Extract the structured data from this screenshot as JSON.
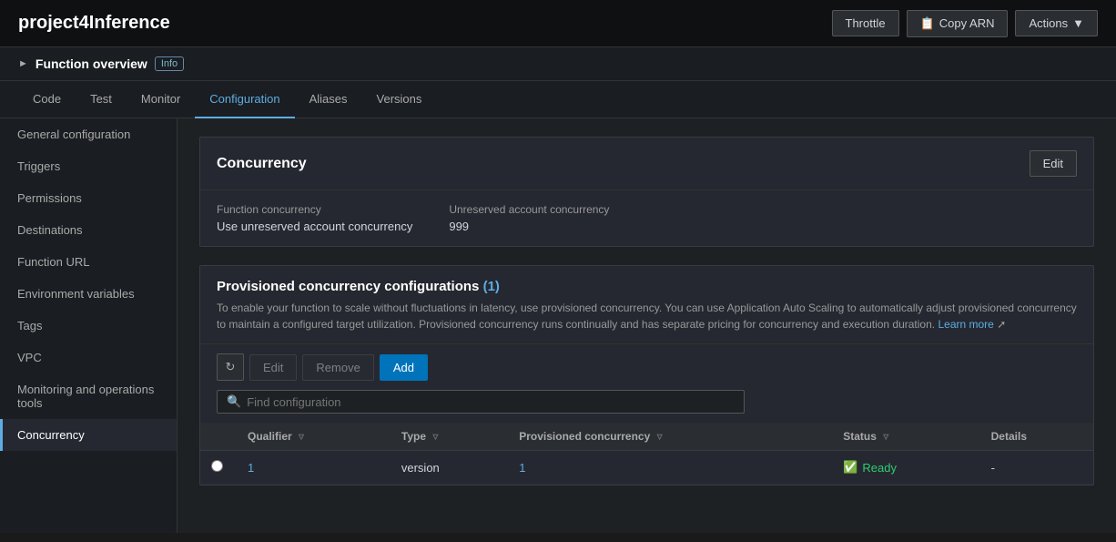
{
  "header": {
    "title": "project4Inference",
    "throttle_label": "Throttle",
    "copy_arn_label": "Copy ARN",
    "actions_label": "Actions"
  },
  "overview": {
    "title": "Function overview",
    "info_label": "Info"
  },
  "tabs": [
    {
      "id": "code",
      "label": "Code"
    },
    {
      "id": "test",
      "label": "Test"
    },
    {
      "id": "monitor",
      "label": "Monitor"
    },
    {
      "id": "configuration",
      "label": "Configuration",
      "active": true
    },
    {
      "id": "aliases",
      "label": "Aliases"
    },
    {
      "id": "versions",
      "label": "Versions"
    }
  ],
  "sidebar": {
    "items": [
      {
        "id": "general",
        "label": "General configuration"
      },
      {
        "id": "triggers",
        "label": "Triggers"
      },
      {
        "id": "permissions",
        "label": "Permissions"
      },
      {
        "id": "destinations",
        "label": "Destinations"
      },
      {
        "id": "function-url",
        "label": "Function URL"
      },
      {
        "id": "env-vars",
        "label": "Environment variables"
      },
      {
        "id": "tags",
        "label": "Tags"
      },
      {
        "id": "vpc",
        "label": "VPC"
      },
      {
        "id": "monitoring",
        "label": "Monitoring and operations tools"
      },
      {
        "id": "concurrency",
        "label": "Concurrency",
        "active": true
      }
    ]
  },
  "concurrency": {
    "title": "Concurrency",
    "edit_label": "Edit",
    "function_concurrency_label": "Function concurrency",
    "function_concurrency_value": "Use unreserved account concurrency",
    "unreserved_label": "Unreserved account concurrency",
    "unreserved_value": "999"
  },
  "provisioned": {
    "title": "Provisioned concurrency configurations",
    "count": "(1)",
    "description": "To enable your function to scale without fluctuations in latency, use provisioned concurrency. You can use Application Auto Scaling to automatically adjust provisioned concurrency to maintain a configured target utilization. Provisioned concurrency runs continually and has separate pricing for concurrency and execution duration.",
    "learn_more": "Learn more",
    "refresh_title": "Refresh",
    "edit_label": "Edit",
    "remove_label": "Remove",
    "add_label": "Add",
    "search_placeholder": "Find configuration",
    "table": {
      "columns": [
        {
          "id": "qualifier",
          "label": "Qualifier"
        },
        {
          "id": "type",
          "label": "Type"
        },
        {
          "id": "provisioned_concurrency",
          "label": "Provisioned concurrency"
        },
        {
          "id": "status",
          "label": "Status"
        },
        {
          "id": "details",
          "label": "Details"
        }
      ],
      "rows": [
        {
          "qualifier": "1",
          "type": "version",
          "provisioned_concurrency": "1",
          "status": "Ready",
          "details": "-"
        }
      ]
    }
  }
}
